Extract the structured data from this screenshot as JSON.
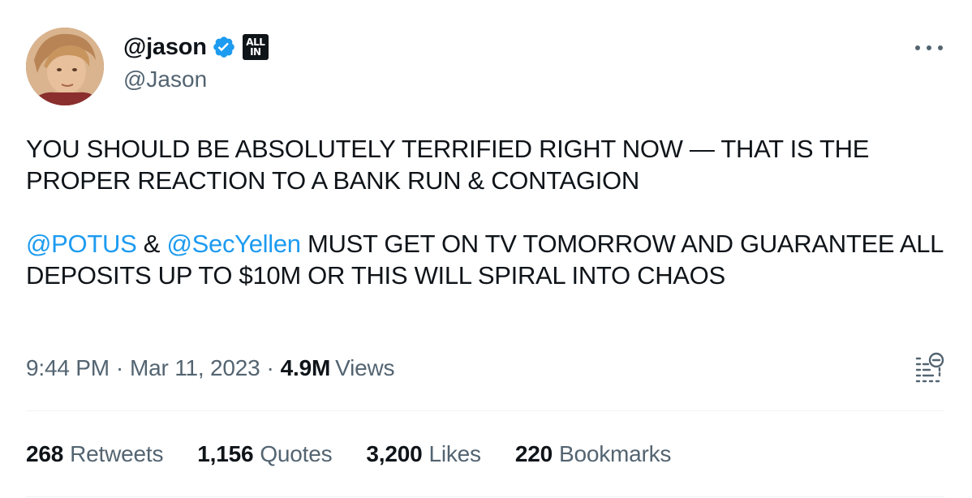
{
  "author": {
    "display_name": "@jason",
    "handle": "@Jason",
    "affiliate_badge": [
      "ALL",
      "IN"
    ]
  },
  "tweet": {
    "line1": "YOU SHOULD BE ABSOLUTELY TERRIFIED RIGHT NOW  — THAT IS THE PROPER REACTION TO A BANK RUN & CONTAGION",
    "mention1": "@POTUS",
    "amp": " & ",
    "mention2": "@SecYellen",
    "line2_rest": " MUST GET ON TV TOMORROW AND GUARANTEE ALL DEPOSITS UP TO $10M OR THIS WILL SPIRAL INTO CHAOS"
  },
  "meta": {
    "time": "9:44 PM",
    "date": "Mar 11, 2023",
    "separator": "·",
    "views_count": "4.9M",
    "views_label": "Views"
  },
  "stats": [
    {
      "num": "268",
      "label": "Retweets"
    },
    {
      "num": "1,156",
      "label": "Quotes"
    },
    {
      "num": "3,200",
      "label": "Likes"
    },
    {
      "num": "220",
      "label": "Bookmarks"
    }
  ],
  "colors": {
    "accent": "#1d9bf0",
    "text": "#0f1419",
    "secondary": "#536471",
    "divider": "#eff3f4"
  },
  "icons": [
    "verified-badge-icon",
    "more-options-icon",
    "analytics-icon"
  ]
}
